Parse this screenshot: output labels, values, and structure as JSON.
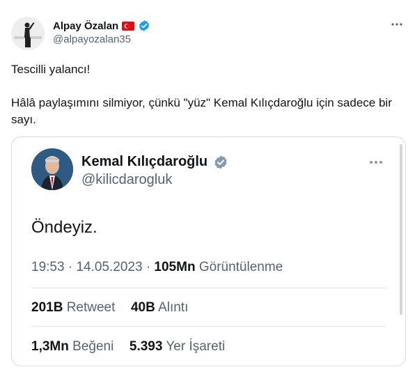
{
  "author": {
    "name": "Alpay Özalan",
    "handle": "@alpayozalan35"
  },
  "tweet": {
    "line1": "Tescilli yalancı!",
    "line2": "Hâlâ paylaşımını silmiyor, çünkü \"yüz\" Kemal Kılıçdaroğlu için sadece bir sayı."
  },
  "quoted": {
    "name": "Kemal Kılıçdaroğlu",
    "handle": "@kilicdarogluk",
    "text": "Öndeyiz.",
    "time": "19:53",
    "date": "14.05.2023",
    "views_count": "105Mn",
    "views_label": "Görüntülenme",
    "retweet_count": "201B",
    "retweet_label": "Retweet",
    "quote_count": "40B",
    "quote_label": "Alıntı",
    "like_count": "1,3Mn",
    "like_label": "Beğeni",
    "bookmark_count": "5.393",
    "bookmark_label": "Yer İşareti"
  },
  "colors": {
    "verified_blue": "#1d9bf0",
    "flag_red": "#e30a17",
    "secondary_text": "#536471",
    "quoted_verified_gray": "#829aab"
  },
  "icons": [
    "verified-badge-icon",
    "turkey-flag-icon",
    "more-options-icon"
  ]
}
